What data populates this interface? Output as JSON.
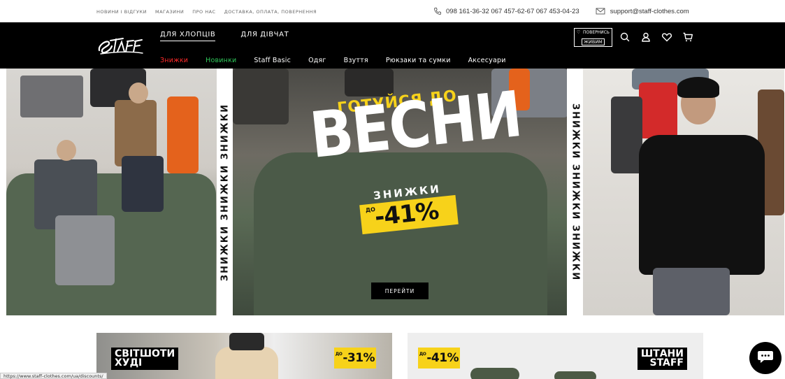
{
  "topbar": {
    "links": [
      "НОВИНИ І ВІДГУКИ",
      "МАГАЗИНИ",
      "ПРО НАС",
      "ДОСТАВКА, ОПЛАТА, ПОВЕРНЕННЯ"
    ],
    "phones": "098 161-36-32  067 457-62-67  067 453-04-23",
    "email": "support@staff-clothes.com"
  },
  "header": {
    "logo_text": "Staff",
    "gender_tabs": [
      "ДЛЯ ХЛОПЦІВ",
      "ДЛЯ ДІВЧАТ"
    ],
    "categories": [
      "Знижки",
      "Новинки",
      "Staff Basic",
      "Одяг",
      "Взуття",
      "Рюкзаки та сумки",
      "Аксесуари"
    ],
    "badge_line1": "ПОВЕРНИСЬ",
    "badge_line2": "ЖИВИМ"
  },
  "hero": {
    "strip_text": "ЗНИЖКИ  ЗНИЖКИ  ЗНИЖКИ",
    "promo_top": "ГОТУЙСЯ ДО",
    "promo_big": "ВЕСНИ",
    "promo_sale": "ЗНИЖКИ",
    "promo_do": "ДО",
    "promo_percent": "-41%",
    "cta": "ПЕРЕЙТИ"
  },
  "cards": [
    {
      "title_line1": "СВІТШОТИ",
      "title_line2": "ХУДІ",
      "badge": "-31%",
      "badge_prefix": "ДО"
    },
    {
      "title_line1": "ШТАНИ",
      "title_line2": "STAFF",
      "badge": "-41%",
      "badge_prefix": "ДО"
    }
  ],
  "status_url": "https://www.staff-clothes.com/ua/discounts/"
}
